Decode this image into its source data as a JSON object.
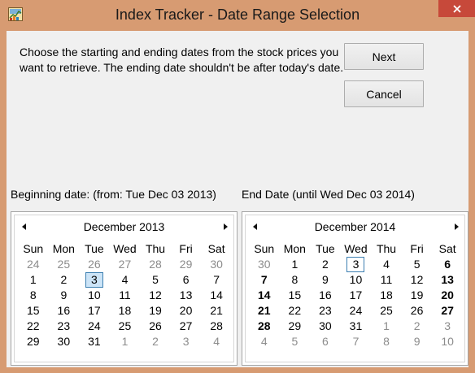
{
  "window": {
    "title": "Index Tracker - Date Range Selection",
    "colors": {
      "frame": "#d79b72",
      "close": "#c7493a",
      "client": "#f0f0f0"
    }
  },
  "instructions": "Choose the starting and ending dates from the stock prices you want to retrieve. The ending date shouldn't be after today's date.",
  "buttons": {
    "next": "Next",
    "cancel": "Cancel"
  },
  "labels": {
    "begin": "Beginning date: (from: Tue Dec 03 2013)",
    "end": "End Date (until Wed Dec 03 2014)"
  },
  "calendars": {
    "begin": {
      "month": "December 2013",
      "weekdays": [
        "Sun",
        "Mon",
        "Tue",
        "Wed",
        "Thu",
        "Fri",
        "Sat"
      ],
      "selected": "3",
      "weeks": [
        [
          {
            "d": "24",
            "m": true
          },
          {
            "d": "25",
            "m": true
          },
          {
            "d": "26",
            "m": true
          },
          {
            "d": "27",
            "m": true
          },
          {
            "d": "28",
            "m": true
          },
          {
            "d": "29",
            "m": true
          },
          {
            "d": "30",
            "m": true
          }
        ],
        [
          {
            "d": "1"
          },
          {
            "d": "2"
          },
          {
            "d": "3",
            "sel": true
          },
          {
            "d": "4"
          },
          {
            "d": "5"
          },
          {
            "d": "6"
          },
          {
            "d": "7"
          }
        ],
        [
          {
            "d": "8"
          },
          {
            "d": "9"
          },
          {
            "d": "10"
          },
          {
            "d": "11"
          },
          {
            "d": "12"
          },
          {
            "d": "13"
          },
          {
            "d": "14"
          }
        ],
        [
          {
            "d": "15"
          },
          {
            "d": "16"
          },
          {
            "d": "17"
          },
          {
            "d": "18"
          },
          {
            "d": "19"
          },
          {
            "d": "20"
          },
          {
            "d": "21"
          }
        ],
        [
          {
            "d": "22"
          },
          {
            "d": "23"
          },
          {
            "d": "24"
          },
          {
            "d": "25"
          },
          {
            "d": "26"
          },
          {
            "d": "27"
          },
          {
            "d": "28"
          }
        ],
        [
          {
            "d": "29"
          },
          {
            "d": "30"
          },
          {
            "d": "31"
          },
          {
            "d": "1",
            "m": true
          },
          {
            "d": "2",
            "m": true
          },
          {
            "d": "3",
            "m": true
          },
          {
            "d": "4",
            "m": true
          }
        ]
      ]
    },
    "end": {
      "month": "December 2014",
      "weekdays": [
        "Sun",
        "Mon",
        "Tue",
        "Wed",
        "Thu",
        "Fri",
        "Sat"
      ],
      "selected": "3",
      "weeks": [
        [
          {
            "d": "30",
            "m": true
          },
          {
            "d": "1"
          },
          {
            "d": "2"
          },
          {
            "d": "3",
            "today": true
          },
          {
            "d": "4"
          },
          {
            "d": "5"
          },
          {
            "d": "6",
            "b": true
          }
        ],
        [
          {
            "d": "7",
            "b": true
          },
          {
            "d": "8"
          },
          {
            "d": "9"
          },
          {
            "d": "10"
          },
          {
            "d": "11"
          },
          {
            "d": "12"
          },
          {
            "d": "13",
            "b": true
          }
        ],
        [
          {
            "d": "14",
            "b": true
          },
          {
            "d": "15"
          },
          {
            "d": "16"
          },
          {
            "d": "17"
          },
          {
            "d": "18"
          },
          {
            "d": "19"
          },
          {
            "d": "20",
            "b": true
          }
        ],
        [
          {
            "d": "21",
            "b": true
          },
          {
            "d": "22"
          },
          {
            "d": "23"
          },
          {
            "d": "24"
          },
          {
            "d": "25"
          },
          {
            "d": "26"
          },
          {
            "d": "27",
            "b": true
          }
        ],
        [
          {
            "d": "28",
            "b": true
          },
          {
            "d": "29"
          },
          {
            "d": "30"
          },
          {
            "d": "31"
          },
          {
            "d": "1",
            "m": true
          },
          {
            "d": "2",
            "m": true
          },
          {
            "d": "3",
            "m": true
          }
        ],
        [
          {
            "d": "4",
            "m": true
          },
          {
            "d": "5",
            "m": true
          },
          {
            "d": "6",
            "m": true
          },
          {
            "d": "7",
            "m": true
          },
          {
            "d": "8",
            "m": true
          },
          {
            "d": "9",
            "m": true
          },
          {
            "d": "10",
            "m": true
          }
        ]
      ]
    }
  }
}
